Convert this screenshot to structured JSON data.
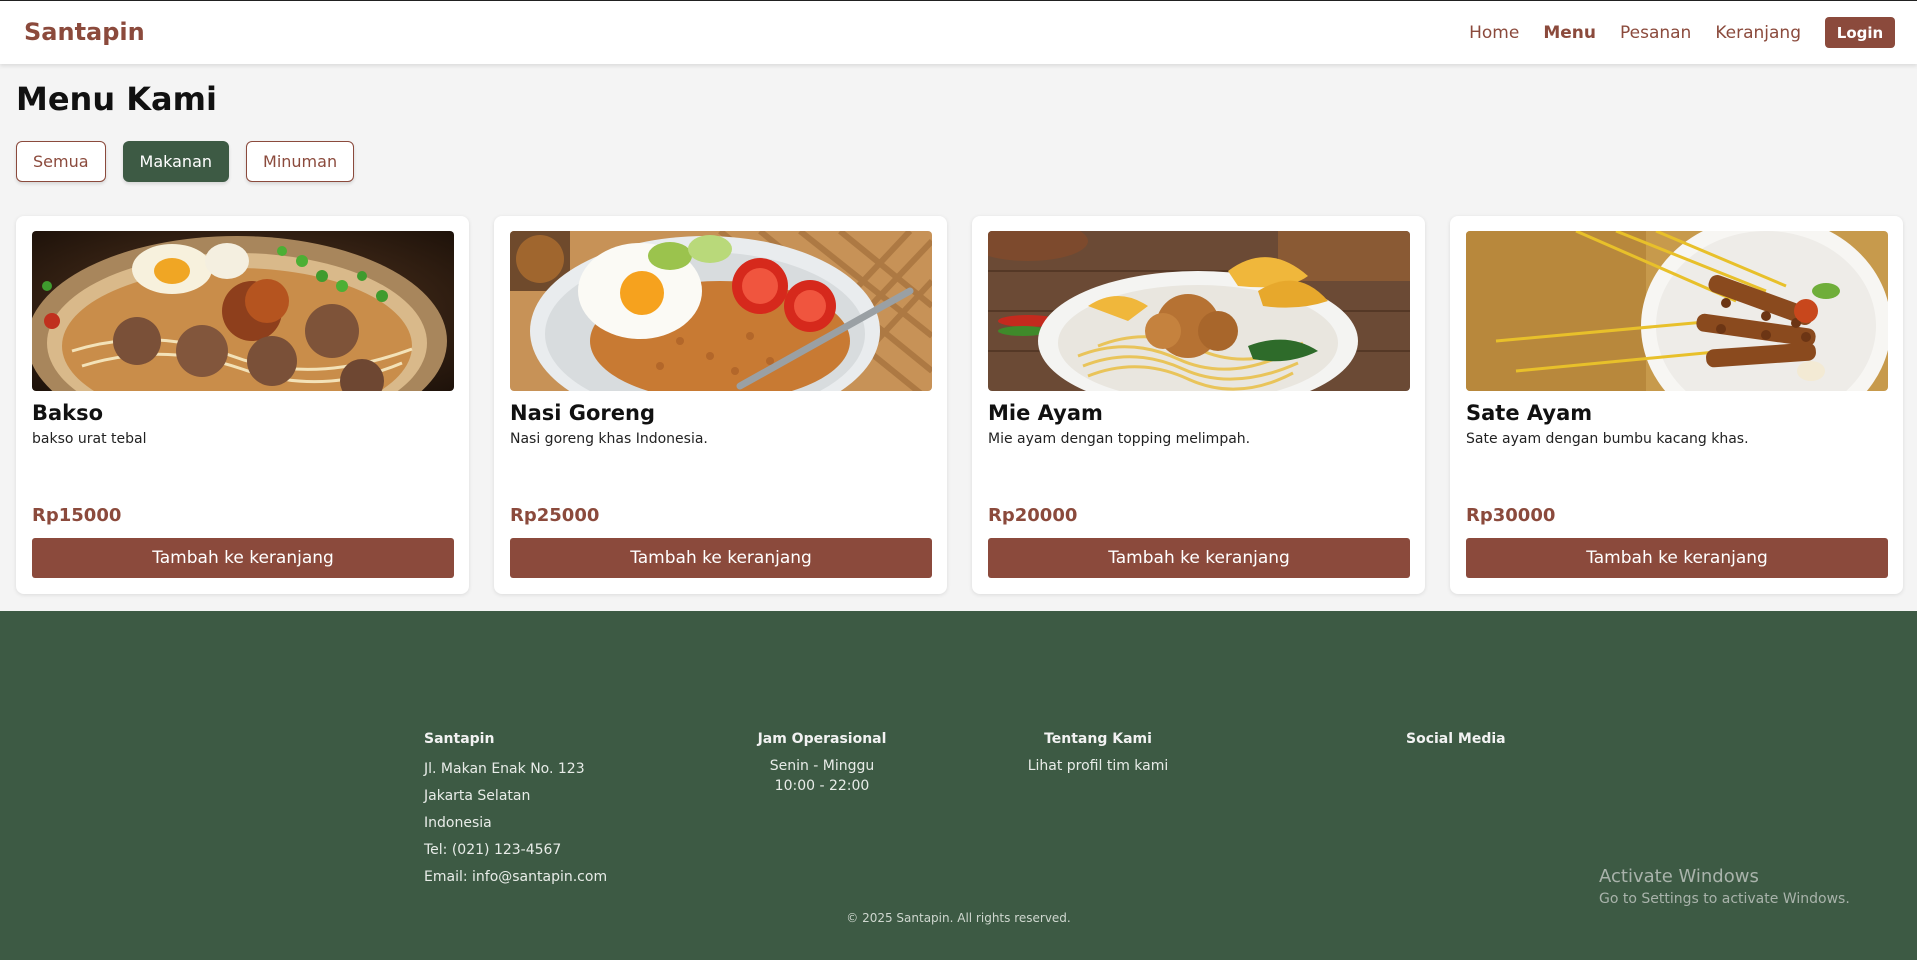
{
  "header": {
    "brand": "Santapin",
    "nav": [
      "Home",
      "Menu",
      "Pesanan",
      "Keranjang"
    ],
    "login": "Login"
  },
  "page": {
    "title": "Menu Kami",
    "filters": [
      "Semua",
      "Makanan",
      "Minuman"
    ],
    "active_filter": "Makanan"
  },
  "menu": [
    {
      "name": "Bakso",
      "desc": "bakso urat tebal",
      "price": "Rp15000",
      "button": "Tambah ke keranjang"
    },
    {
      "name": "Nasi Goreng",
      "desc": "Nasi goreng khas Indonesia.",
      "price": "Rp25000",
      "button": "Tambah ke keranjang"
    },
    {
      "name": "Mie Ayam",
      "desc": "Mie ayam dengan topping melimpah.",
      "price": "Rp20000",
      "button": "Tambah ke keranjang"
    },
    {
      "name": "Sate Ayam",
      "desc": "Sate ayam dengan bumbu kacang khas.",
      "price": "Rp30000",
      "button": "Tambah ke keranjang"
    }
  ],
  "footer": {
    "col1": {
      "title": "Santapin",
      "lines": [
        "Jl. Makan Enak No. 123",
        "Jakarta Selatan",
        "Indonesia",
        "Tel: (021) 123-4567",
        "Email: info@santapin.com"
      ]
    },
    "col2": {
      "title": "Jam Operasional",
      "lines": [
        "Senin - Minggu",
        "10:00 - 22:00"
      ]
    },
    "col3": {
      "title": "Tentang Kami",
      "link": "Lihat profil tim kami"
    },
    "col4": {
      "title": "Social Media"
    },
    "copyright": "© 2025 Santapin. All rights reserved."
  },
  "os_watermark": {
    "line1": "Activate Windows",
    "line2": "Go to Settings to activate Windows."
  },
  "colors": {
    "brand": "#8b4a3c",
    "green": "#3d5a44",
    "background": "#f4f4f4"
  }
}
